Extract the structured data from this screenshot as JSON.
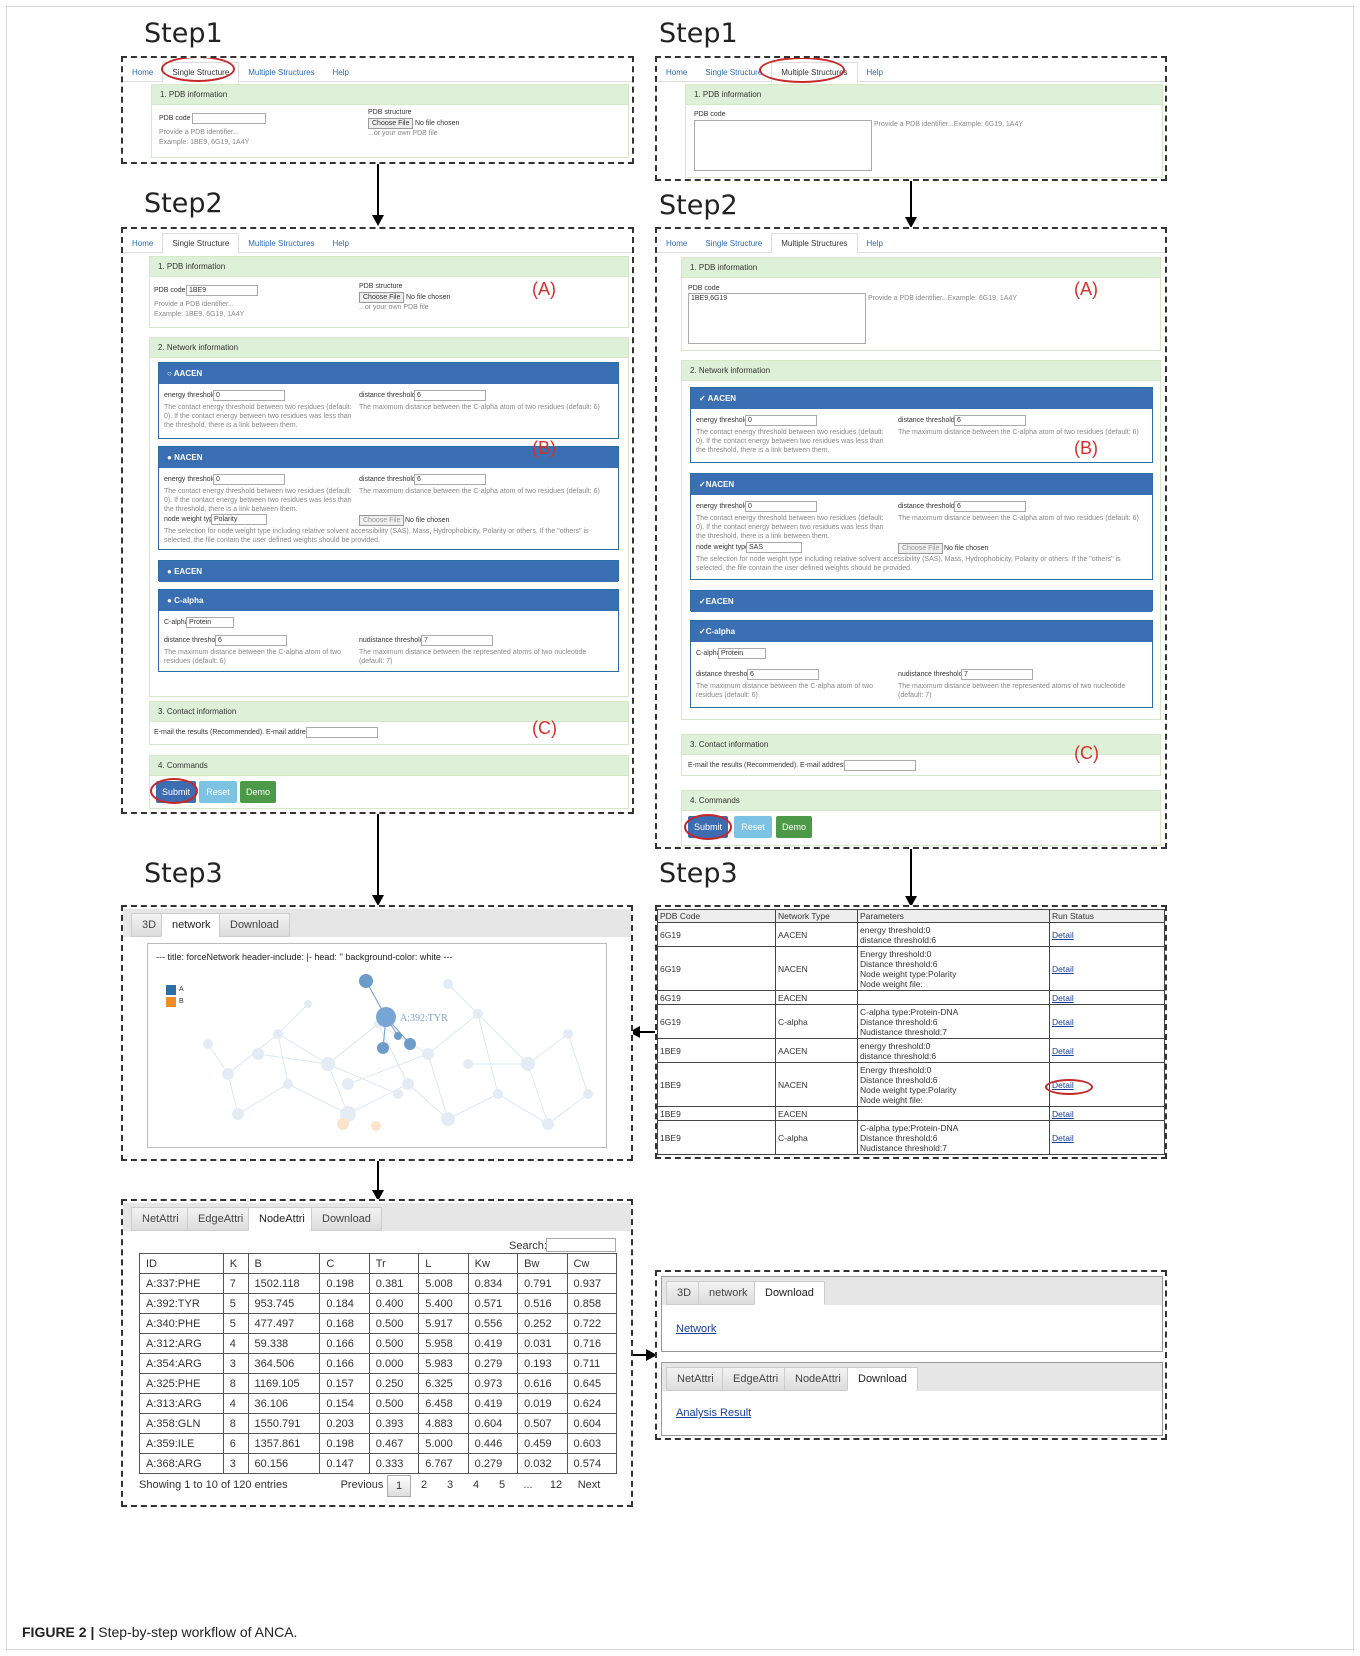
{
  "step_labels": {
    "s1": "Step1",
    "s2": "Step2",
    "s3": "Step3"
  },
  "tabs": {
    "home": "Home",
    "single": "Single Structure",
    "multiple": "Multiple Structures",
    "help": "Help"
  },
  "pdb": {
    "section": "1. PDB information",
    "code_label": "PDB code",
    "hint1": "Provide a PDB identifier...",
    "hint2": "Example: 1BE9, 6G19, 1A4Y",
    "structure_label": "PDB structure",
    "choose": "Choose File",
    "nofile": "No file chosen",
    "own": "...or your own PDB file",
    "multi_hint": "Provide a PDB identifier...Example: 6G19, 1A4Y",
    "single_value": "1BE9",
    "multi_value": "1BE9,6G19"
  },
  "network": {
    "section": "2. Network information",
    "aacen": "AACEN",
    "nacen": "NACEN",
    "eacen": "EACEN",
    "calpha": "C-alpha",
    "check": "✓",
    "energy_label": "energy threshold",
    "energy_value": "0",
    "distance_label": "distance threshold",
    "distance_value": "6",
    "energy_desc": "The contact energy threshold between two residues (default: 0). If the contact energy between two residues was less than the threshold, there is a link between them.",
    "distance_desc": "The maximum distance between the C-alpha atom of two residues (default: 6)",
    "nodeweight_label": "node weight type",
    "nodeweight_single": "Polarity",
    "nodeweight_multi": "SAS",
    "nodeweight_desc": "The selection for node weight type including relative solvent accessibility (SAS), Mass, Hydrophobicity, Polarity or others. If the \"others\" is selected, the file contain the user defined weights should be provided.",
    "calpha_label": "C-alpha",
    "calpha_value": "Protein",
    "nud_label": "nudistance threshold",
    "nud_value": "7",
    "ca_desc": "The maximum distance between the C-alpha atom of two residues (default: 6)",
    "nud_desc": "The maximum distance between the represented atoms of two nucleotide (default: 7)"
  },
  "contact": {
    "section": "3. Contact information",
    "email_label": "E-mail the results (Recommended). E-mail address:"
  },
  "commands": {
    "section": "4. Commands",
    "submit": "Submit",
    "reset": "Reset",
    "demo": "Demo"
  },
  "labels": {
    "a": "(A)",
    "b": "(B)",
    "c": "(C)"
  },
  "viewer": {
    "tabs": [
      "3D",
      "network",
      "Download"
    ],
    "title": "--- title: forceNetwork header-include: |- head: '' background-color: white ---",
    "legend": [
      "A",
      "B"
    ],
    "node_label": "A:392:TYR"
  },
  "results": {
    "headers": [
      "PDB Code",
      "Network Type",
      "Parameters",
      "Run Status"
    ],
    "detail": "Detail",
    "rows": [
      {
        "code": "6G19",
        "type": "AACEN",
        "params": [
          "energy threshold:0",
          "distance threshold:6"
        ]
      },
      {
        "code": "6G19",
        "type": "NACEN",
        "params": [
          "Energy threshold:0",
          "Distance threshold:6",
          "Node weight type:Polarity",
          "Node weight file:"
        ]
      },
      {
        "code": "6G19",
        "type": "EACEN",
        "params": [
          ""
        ]
      },
      {
        "code": "6G19",
        "type": "C-alpha",
        "params": [
          "C-alpha type:Protein-DNA",
          "Distance threshold:6",
          "Nudistance threshold:7"
        ]
      },
      {
        "code": "1BE9",
        "type": "AACEN",
        "params": [
          "energy threshold:0",
          "distance threshold:6"
        ]
      },
      {
        "code": "1BE9",
        "type": "NACEN",
        "params": [
          "Energy threshold:0",
          "Distance threshold:6",
          "Node weight type:Polarity",
          "Node weight file:"
        ]
      },
      {
        "code": "1BE9",
        "type": "EACEN",
        "params": [
          ""
        ]
      },
      {
        "code": "1BE9",
        "type": "C-alpha",
        "params": [
          "C-alpha type:Protein-DNA",
          "Distance threshold:6",
          "Nudistance threshold:7"
        ]
      }
    ]
  },
  "attr": {
    "tabs": [
      "NetAttri",
      "EdgeAttri",
      "NodeAttri",
      "Download"
    ],
    "search": "Search:",
    "headers": [
      "ID",
      "K",
      "B",
      "C",
      "Tr",
      "L",
      "Kw",
      "Bw",
      "Cw"
    ],
    "rows": [
      [
        "A:337:PHE",
        "7",
        "1502.118",
        "0.198",
        "0.381",
        "5.008",
        "0.834",
        "0.791",
        "0.937"
      ],
      [
        "A:392:TYR",
        "5",
        "953.745",
        "0.184",
        "0.400",
        "5.400",
        "0.571",
        "0.516",
        "0.858"
      ],
      [
        "A:340:PHE",
        "5",
        "477.497",
        "0.168",
        "0.500",
        "5.917",
        "0.556",
        "0.252",
        "0.722"
      ],
      [
        "A:312:ARG",
        "4",
        "59.338",
        "0.166",
        "0.500",
        "5.958",
        "0.419",
        "0.031",
        "0.716"
      ],
      [
        "A:354:ARG",
        "3",
        "364.506",
        "0.166",
        "0.000",
        "5.983",
        "0.279",
        "0.193",
        "0.711"
      ],
      [
        "A:325:PHE",
        "8",
        "1169.105",
        "0.157",
        "0.250",
        "6.325",
        "0.973",
        "0.616",
        "0.645"
      ],
      [
        "A:313:ARG",
        "4",
        "36.106",
        "0.154",
        "0.500",
        "6.458",
        "0.419",
        "0.019",
        "0.624"
      ],
      [
        "A:358:GLN",
        "8",
        "1550.791",
        "0.203",
        "0.393",
        "4.883",
        "0.604",
        "0.507",
        "0.604"
      ],
      [
        "A:359:ILE",
        "6",
        "1357.861",
        "0.198",
        "0.467",
        "5.000",
        "0.446",
        "0.459",
        "0.603"
      ],
      [
        "A:368:ARG",
        "3",
        "60.156",
        "0.147",
        "0.333",
        "6.767",
        "0.279",
        "0.032",
        "0.574"
      ]
    ],
    "info": "Showing 1 to 10 of 120 entries",
    "pager": [
      "Previous",
      "1",
      "2",
      "3",
      "4",
      "5",
      "...",
      "12",
      "Next"
    ]
  },
  "downloads": {
    "tabs1": [
      "3D",
      "network",
      "Download"
    ],
    "link1": "Network",
    "tabs2": [
      "NetAttri",
      "EdgeAttri",
      "NodeAttri",
      "Download"
    ],
    "link2": "Analysis Result"
  },
  "caption": {
    "label": "FIGURE 2 |",
    "text": "Step-by-step workflow of ANCA."
  },
  "colors": {
    "accent": "#3b6fb3",
    "submit": "#3d6db0",
    "reset": "#7cc3e3",
    "demo": "#4c9a48",
    "oval": "#c62828",
    "label_red": "#d9302c",
    "legend_a": "#2b6fa6",
    "legend_b": "#f28c28"
  }
}
